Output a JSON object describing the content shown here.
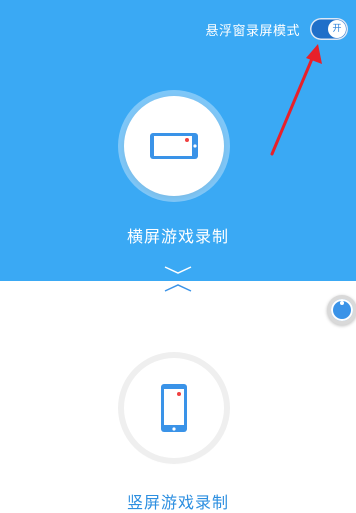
{
  "header": {
    "floating_record_label": "悬浮窗录屏模式",
    "toggle_state_text": "开"
  },
  "modes": {
    "landscape_label": "横屏游戏录制",
    "portrait_label": "竖屏游戏录制"
  },
  "colors": {
    "primary_blue": "#3aa9f4",
    "toggle_on": "#1f6fc9",
    "icon_blue": "#3a93e8",
    "record_dot": "#f04040",
    "annotation_arrow": "#e8202a",
    "portrait_label_color": "#2d8fe0"
  },
  "icons": {
    "landscape": "landscape-phone-icon",
    "portrait": "portrait-phone-icon",
    "toggle_pointer": "red-arrow-annotation",
    "floating_ball": "floating-ball-icon"
  }
}
